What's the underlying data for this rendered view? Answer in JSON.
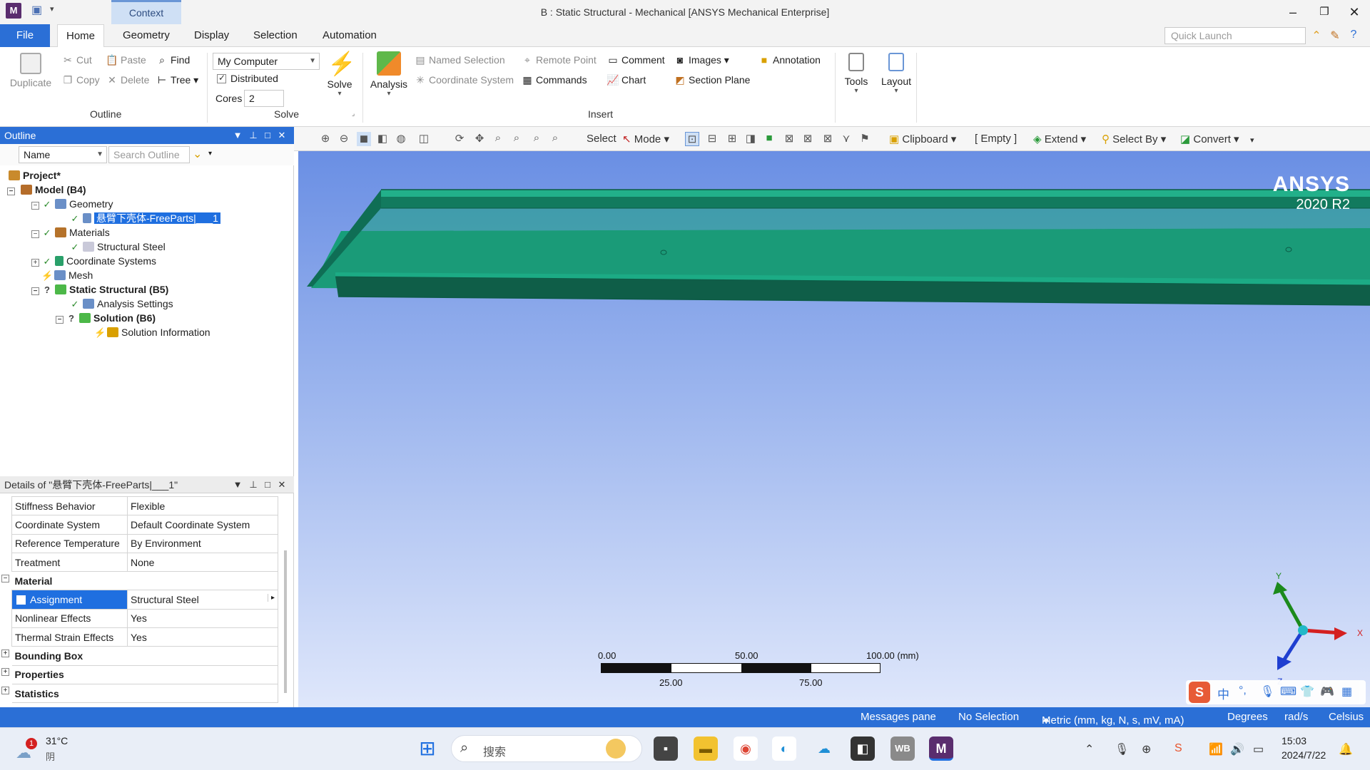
{
  "window": {
    "app_badge": "M",
    "context_tab": "Context",
    "title": "B : Static Structural - Mechanical [ANSYS Mechanical Enterprise]"
  },
  "ribbon_tabs": [
    "File",
    "Home",
    "Geometry",
    "Display",
    "Selection",
    "Automation"
  ],
  "quick_launch_placeholder": "Quick Launch",
  "ribbon": {
    "outline": {
      "duplicate": "Duplicate",
      "cut": "Cut",
      "copy": "Copy",
      "paste": "Paste",
      "delete": "Delete",
      "find": "Find",
      "tree": "Tree",
      "label": "Outline"
    },
    "solve": {
      "computer": "My Computer",
      "distributed": "Distributed",
      "cores_label": "Cores",
      "cores_value": "2",
      "solve": "Solve",
      "label": "Solve"
    },
    "insert": {
      "analysis": "Analysis",
      "named_selection": "Named Selection",
      "coordinate_system": "Coordinate System",
      "remote_point": "Remote Point",
      "commands": "Commands",
      "comment": "Comment",
      "chart": "Chart",
      "images": "Images",
      "section_plane": "Section Plane",
      "annotation": "Annotation",
      "label": "Insert"
    },
    "tools": "Tools",
    "layout": "Layout"
  },
  "outline_panel": {
    "title": "Outline",
    "name_filter": "Name",
    "search_placeholder": "Search Outline",
    "tree": [
      {
        "label": "Project*"
      },
      {
        "label": "Model (B4)"
      },
      {
        "label": "Geometry"
      },
      {
        "label": "悬臂下壳体-FreeParts|___1"
      },
      {
        "label": "Materials"
      },
      {
        "label": "Structural Steel"
      },
      {
        "label": "Coordinate Systems"
      },
      {
        "label": "Mesh"
      },
      {
        "label": "Static Structural (B5)"
      },
      {
        "label": "Analysis Settings"
      },
      {
        "label": "Solution (B6)"
      },
      {
        "label": "Solution Information"
      }
    ]
  },
  "details_panel": {
    "title": "Details of \"悬臂下壳体-FreeParts|___1\"",
    "rows": [
      {
        "key": "Stiffness Behavior",
        "value": "Flexible"
      },
      {
        "key": "Coordinate System",
        "value": "Default Coordinate System"
      },
      {
        "key": "Reference Temperature",
        "value": "By Environment"
      },
      {
        "key": "Treatment",
        "value": "None"
      }
    ],
    "material_category": "Material",
    "material_rows": [
      {
        "key": "Assignment",
        "value": "Structural Steel"
      },
      {
        "key": "Nonlinear Effects",
        "value": "Yes"
      },
      {
        "key": "Thermal Strain Effects",
        "value": "Yes"
      }
    ],
    "categories": [
      "Bounding Box",
      "Properties",
      "Statistics"
    ]
  },
  "graphics_toolbar": {
    "select": "Select",
    "mode": "Mode",
    "clipboard": "Clipboard",
    "empty": "[ Empty ]",
    "extend": "Extend",
    "select_by": "Select By",
    "convert": "Convert"
  },
  "viewport": {
    "logo": "ANSYS",
    "version": "2020 R2",
    "scale_top": [
      "0.00",
      "50.00",
      "100.00 (mm)"
    ],
    "scale_bottom": [
      "25.00",
      "75.00"
    ],
    "axis_x": "X",
    "axis_y": "Y",
    "axis_z": "Z",
    "body_color": "#1a9b78"
  },
  "status_bar": {
    "messages": "Messages pane",
    "selection": "No Selection",
    "units": "Metric (mm, kg, N, s, mV, mA)",
    "angle": "Degrees",
    "rate": "rad/s",
    "temp": "Celsius"
  },
  "taskbar": {
    "weather_badge": "1",
    "temp": "31°C",
    "cond": "阴",
    "search": "搜索",
    "ime": "中",
    "time": "15:03",
    "date": "2024/7/22",
    "wb_label": "WB",
    "m_label": "M"
  },
  "colors": {
    "accent": "#2b6fd6",
    "selection": "#1f6fe0",
    "body": "#1a9b78"
  }
}
